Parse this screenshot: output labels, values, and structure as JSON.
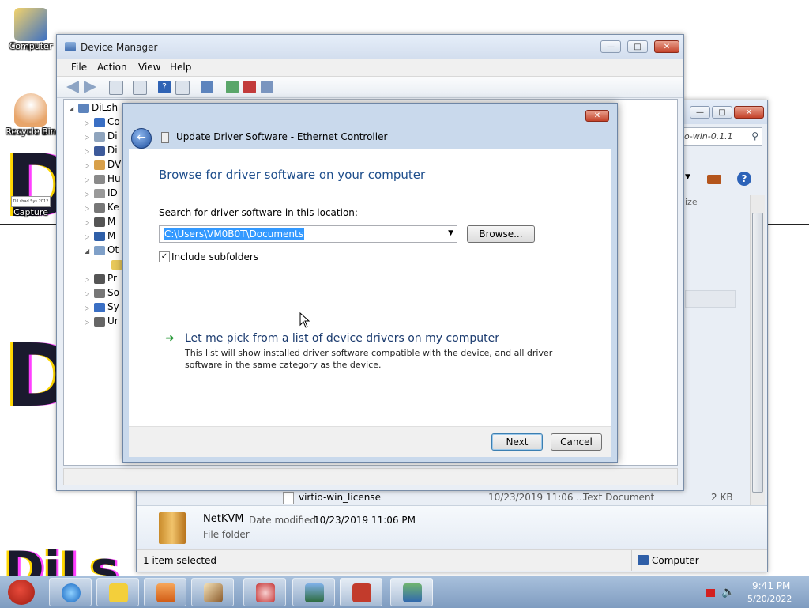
{
  "desktop": {
    "icons": [
      {
        "label": "Computer"
      },
      {
        "label": "Recycle Bin"
      },
      {
        "label": "Capture",
        "thumb_text": "DiLshad Sys 2012"
      }
    ]
  },
  "device_manager": {
    "title": "Device Manager",
    "menu": [
      "File",
      "Action",
      "View",
      "Help"
    ],
    "tree_root": "DiLsh",
    "tree_items": [
      "Co",
      "Di",
      "Di",
      "DV",
      "Hu",
      "ID",
      "Ke",
      "M",
      "M",
      "Ot",
      "Pr",
      "So",
      "Sy",
      "Ur"
    ]
  },
  "explorer": {
    "search_text": "o-win-0.1.1",
    "column_partial": "ize",
    "file_row": {
      "name": "virtio-win_license",
      "date": "10/23/2019 11:06 ...",
      "type": "Text Document",
      "size": "2 KB"
    },
    "details": {
      "name": "NetKVM",
      "date_label": "Date modified:",
      "date_value": "10/23/2019 11:06 PM",
      "kind": "File folder"
    },
    "status": "1 item selected",
    "status_location": "Computer"
  },
  "dialog": {
    "title": "Update Driver Software - Ethernet Controller",
    "heading": "Browse for driver software on your computer",
    "search_label": "Search for driver software in this location:",
    "path_value": "C:\\Users\\VM0B0T\\Documents",
    "browse_button": "Browse...",
    "include_subfolders": "Include subfolders",
    "include_subfolders_checked": true,
    "pick_title": "Let me pick from a list of device drivers on my computer",
    "pick_desc_line1": "This list will show installed driver software compatible with the device, and all driver",
    "pick_desc_line2": "software in the same category as the device.",
    "next_button": "Next",
    "cancel_button": "Cancel"
  },
  "taskbar": {
    "time": "9:41 PM",
    "date": "5/20/2022",
    "apps": [
      "angry-birds",
      "internet-explorer",
      "windows-explorer",
      "media-player",
      "paint",
      "snipping-tool",
      "picture-viewer",
      "toolbox",
      "device-manager"
    ]
  },
  "colors": {
    "heading_blue": "#1e4e8c",
    "link_blue": "#1a3a6e",
    "selection": "#3399ff",
    "close_red": "#c4432a"
  }
}
